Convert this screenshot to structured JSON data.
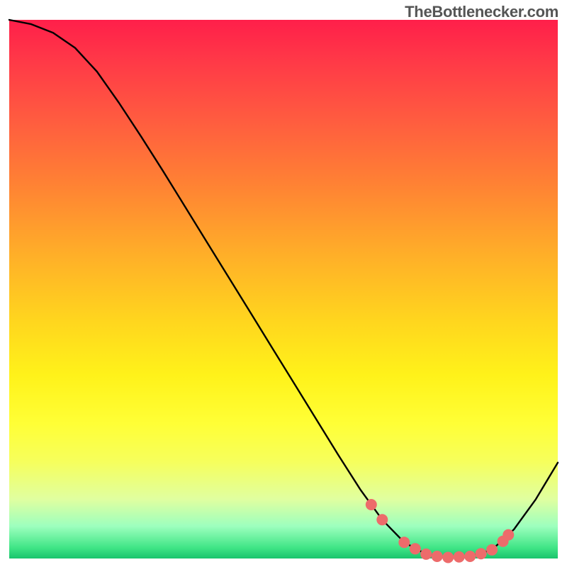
{
  "watermark": "TheBottlenecker.com",
  "chart_data": {
    "type": "line",
    "title": "",
    "xlabel": "",
    "ylabel": "",
    "xlim": [
      0,
      100
    ],
    "ylim": [
      0,
      100
    ],
    "legend": null,
    "grid": false,
    "series": [
      {
        "name": "curve",
        "x": [
          0,
          4,
          8,
          12,
          16,
          20,
          24,
          28,
          32,
          36,
          40,
          44,
          48,
          52,
          56,
          60,
          64,
          68,
          72,
          76,
          80,
          84,
          88,
          92,
          96,
          100
        ],
        "y": [
          100,
          99.2,
          97.6,
          94.8,
          90.4,
          84.6,
          78.4,
          72.0,
          65.4,
          58.8,
          52.2,
          45.6,
          39.0,
          32.4,
          25.8,
          19.2,
          12.8,
          7.2,
          3.0,
          0.8,
          0.2,
          0.4,
          1.6,
          5.4,
          11.0,
          17.8
        ]
      }
    ],
    "markers": {
      "name": "highlight-dots",
      "x": [
        66,
        68,
        72,
        74,
        76,
        78,
        80,
        82,
        84,
        86,
        88,
        90,
        91
      ],
      "y": [
        10.0,
        7.2,
        3.0,
        1.8,
        0.8,
        0.4,
        0.2,
        0.3,
        0.4,
        0.9,
        1.6,
        3.2,
        4.4
      ],
      "color": "#ed6b6b",
      "size": 8
    },
    "colors": {
      "line": "#000000",
      "gradient_top": "#ff1f4a",
      "gradient_bottom": "#19c46d"
    }
  }
}
